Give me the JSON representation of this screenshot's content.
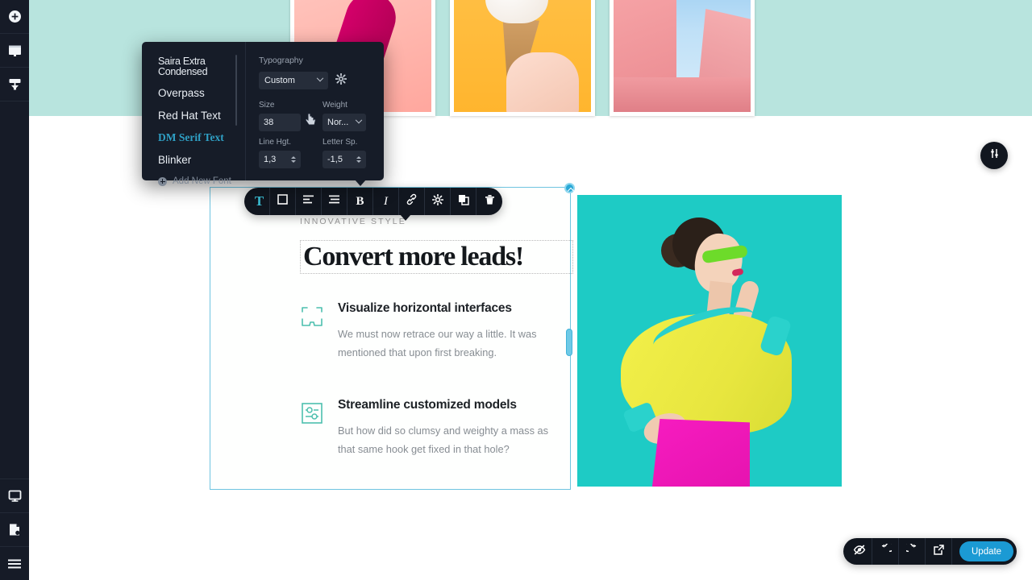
{
  "app": {
    "accent_blue": "#1b9ad4",
    "accent_teal": "#3bbfd4",
    "panel_bg": "#161c28",
    "mint_band": "#b8e4de",
    "hero_bg": "#1ecbc5"
  },
  "sidebar": {
    "top_items": [
      {
        "name": "add-element",
        "icon": "plus-circle-icon"
      },
      {
        "name": "sections",
        "icon": "window-icon"
      },
      {
        "name": "theme-styles",
        "icon": "paint-roller-icon"
      }
    ],
    "bottom_items": [
      {
        "name": "responsive-preview",
        "icon": "monitor-icon"
      },
      {
        "name": "pages",
        "icon": "page-icon"
      },
      {
        "name": "main-menu",
        "icon": "hamburger-icon"
      }
    ]
  },
  "gallery": {
    "cards": [
      {
        "name": "photo-card-lipstick",
        "alt": "Pink lipstick on coral background"
      },
      {
        "name": "photo-card-icecream",
        "alt": "Melting ice cream cone on yellow background"
      },
      {
        "name": "photo-card-architecture",
        "alt": "Pink building against blue sky"
      }
    ]
  },
  "element_toolbar": {
    "buttons": [
      {
        "label": "T",
        "name": "text-tool",
        "active": true
      },
      {
        "label": "box",
        "name": "container-tool",
        "active": false
      },
      {
        "label": "align-left",
        "name": "align-left-tool",
        "active": false
      },
      {
        "label": "align-justify",
        "name": "align-justify-tool",
        "active": false
      },
      {
        "label": "B",
        "name": "bold-tool",
        "active": false
      },
      {
        "label": "I",
        "name": "italic-tool",
        "active": false
      },
      {
        "label": "link",
        "name": "link-tool",
        "active": false
      },
      {
        "label": "gear",
        "name": "settings-tool",
        "active": false
      },
      {
        "label": "duplicate",
        "name": "duplicate-tool",
        "active": false
      },
      {
        "label": "trash",
        "name": "delete-tool",
        "active": false
      }
    ]
  },
  "typography_panel": {
    "title": "Typography",
    "fonts": [
      "Saira Extra Condensed",
      "Overpass",
      "Red Hat Text",
      "DM Serif Text",
      "Blinker"
    ],
    "selected_font": "DM Serif Text",
    "add_new_font": "Add New Font",
    "preset": {
      "label": "Custom"
    },
    "fields": [
      {
        "label": "Size",
        "value": "38"
      },
      {
        "label": "Weight",
        "value": "Nor..."
      },
      {
        "label": "Line Hgt.",
        "value": "1,3"
      },
      {
        "label": "Letter Sp.",
        "value": "-1,5"
      }
    ]
  },
  "content": {
    "eyebrow": "INNOVATIVE STYLE",
    "headline": "Convert more leads!",
    "features": [
      {
        "icon": "bracket-frame-icon",
        "title": "Visualize horizontal interfaces",
        "body": "We must now retrace our way a little. It was mentioned that upon first breaking."
      },
      {
        "icon": "node-settings-icon",
        "title": "Streamline customized models",
        "body": "But how did so clumsy and weighty a mass as that same hook get fixed in that hole?"
      }
    ],
    "hero_image_alt": "Fashion model in yellow top and pink skirt on turquoise background"
  },
  "float_button": {
    "name": "adjustments-button",
    "icon": "sliders-vertical-icon"
  },
  "action_bar": {
    "buttons": [
      {
        "name": "hide-preview",
        "icon": "eye-slash-icon"
      },
      {
        "name": "undo",
        "icon": "undo-icon"
      },
      {
        "name": "redo",
        "icon": "redo-icon"
      },
      {
        "name": "open-external",
        "icon": "external-link-icon"
      }
    ],
    "update_label": "Update"
  }
}
